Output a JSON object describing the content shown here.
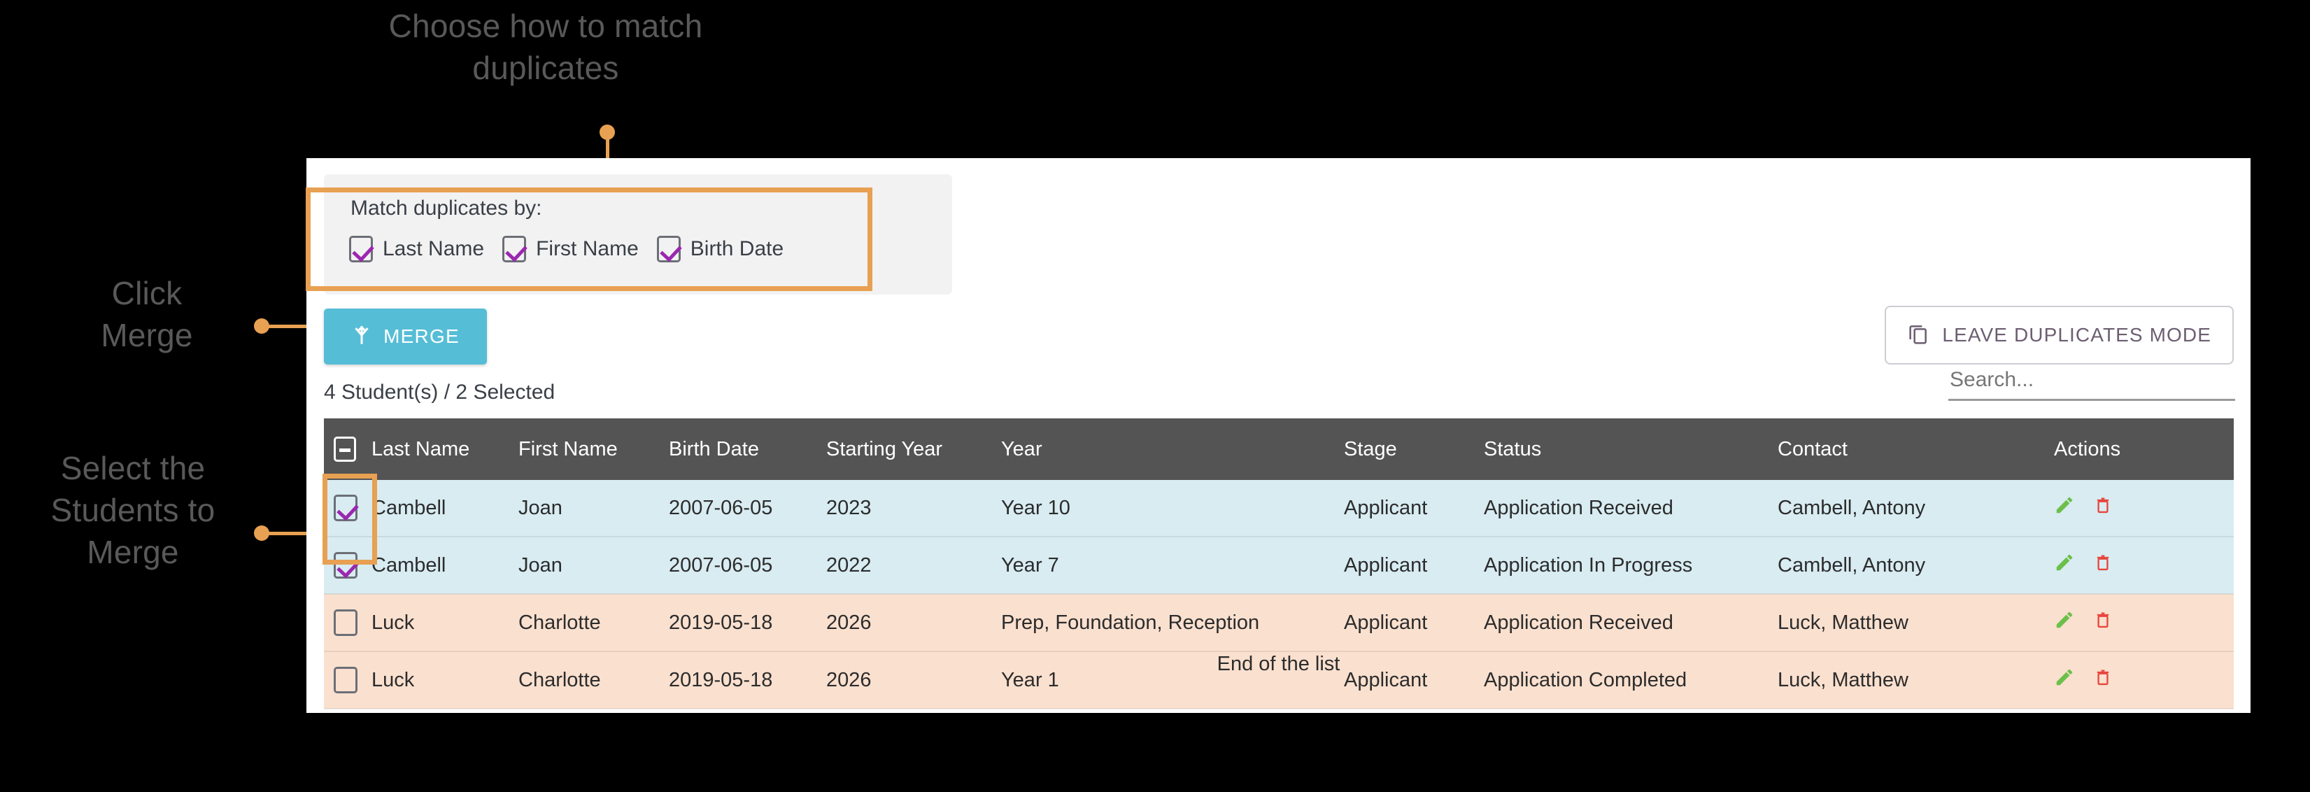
{
  "annotations": {
    "top": "Choose how to match\nduplicates",
    "click_merge": "Click\nMerge",
    "select_students": "Select the\nStudents to\nMerge"
  },
  "match_panel": {
    "title": "Match duplicates by:",
    "options": [
      {
        "label": "Last Name",
        "checked": true
      },
      {
        "label": "First Name",
        "checked": true
      },
      {
        "label": "Birth Date",
        "checked": true
      }
    ]
  },
  "toolbar": {
    "merge_label": "MERGE",
    "merge_icon": "call-merge-icon",
    "leave_label": "LEAVE DUPLICATES MODE",
    "leave_icon": "content-copy-icon"
  },
  "summary": "4 Student(s) / 2 Selected",
  "search": {
    "placeholder": "Search...",
    "value": ""
  },
  "table": {
    "columns": [
      "",
      "Last Name",
      "First Name",
      "Birth Date",
      "Starting Year",
      "Year",
      "Stage",
      "Status",
      "Contact",
      "Actions"
    ],
    "header_checkbox_state": "indeterminate",
    "rows": [
      {
        "checked": true,
        "selected": true,
        "last_name": "Cambell",
        "first_name": "Joan",
        "birth_date": "2007-06-05",
        "starting_year": "2023",
        "year": "Year 10",
        "stage": "Applicant",
        "status": "Application Received",
        "contact": "Cambell, Antony"
      },
      {
        "checked": true,
        "selected": true,
        "last_name": "Cambell",
        "first_name": "Joan",
        "birth_date": "2007-06-05",
        "starting_year": "2022",
        "year": "Year 7",
        "stage": "Applicant",
        "status": "Application In Progress",
        "contact": "Cambell, Antony"
      },
      {
        "checked": false,
        "selected": false,
        "last_name": "Luck",
        "first_name": "Charlotte",
        "birth_date": "2019-05-18",
        "starting_year": "2026",
        "year": "Prep, Foundation, Reception",
        "stage": "Applicant",
        "status": "Application Received",
        "contact": "Luck, Matthew"
      },
      {
        "checked": false,
        "selected": false,
        "last_name": "Luck",
        "first_name": "Charlotte",
        "birth_date": "2019-05-18",
        "starting_year": "2026",
        "year": "Year 1",
        "stage": "Applicant",
        "status": "Application Completed",
        "contact": "Luck, Matthew"
      }
    ],
    "row_actions": {
      "edit_icon": "pencil-icon",
      "delete_icon": "trash-icon"
    }
  },
  "footer": "End of the list",
  "colors": {
    "accent_orange": "#e8a052",
    "merge_blue": "#56bdd6",
    "header_gray": "#545454",
    "row_selected": "#d8ecf2",
    "row_unselected": "#fae0cf",
    "check_purple": "#9b27b0",
    "edit_green": "#6cc04a",
    "delete_red": "#e8453c"
  }
}
